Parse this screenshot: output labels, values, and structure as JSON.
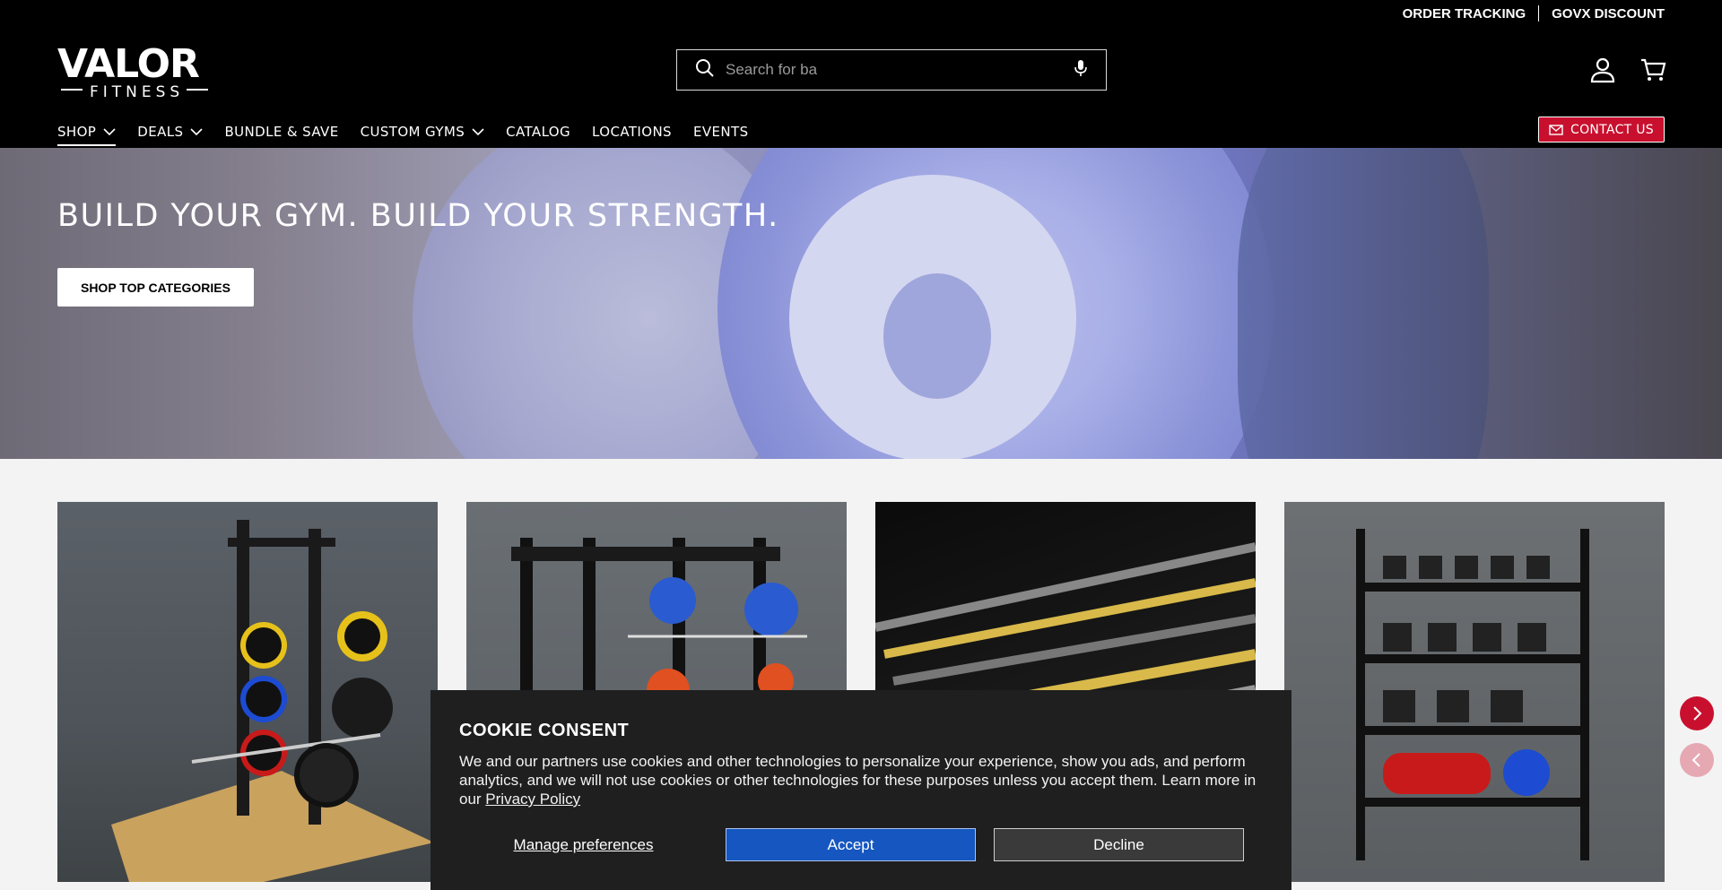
{
  "header": {
    "util_links": [
      "ORDER TRACKING",
      "GOVX DISCOUNT"
    ],
    "logo_top": "VALOR",
    "logo_bottom": "FITNESS",
    "search_placeholder": "Search for ba",
    "nav": [
      {
        "label": "SHOP",
        "has_chevron": true
      },
      {
        "label": "DEALS",
        "has_chevron": true
      },
      {
        "label": "BUNDLE & SAVE",
        "has_chevron": false
      },
      {
        "label": "CUSTOM GYMS",
        "has_chevron": true
      },
      {
        "label": "CATALOG",
        "has_chevron": false
      },
      {
        "label": "LOCATIONS",
        "has_chevron": false
      },
      {
        "label": "EVENTS",
        "has_chevron": false
      }
    ],
    "contact_label": "CONTACT US"
  },
  "hero": {
    "title": "BUILD YOUR GYM. BUILD YOUR STRENGTH.",
    "button_label": "SHOP TOP CATEGORIES"
  },
  "cookie": {
    "title": "COOKIE CONSENT",
    "body": "We and our partners use cookies and other technologies to personalize your experience, show you ads, and perform analytics, and we will not use cookies or other technologies for these purposes unless you accept them. Learn more in our ",
    "privacy_link": "Privacy Policy",
    "manage_label": "Manage preferences",
    "accept_label": "Accept",
    "decline_label": "Decline"
  },
  "colors": {
    "accent": "#c8102e",
    "accept": "#1556c0",
    "header_bg": "#000000"
  }
}
